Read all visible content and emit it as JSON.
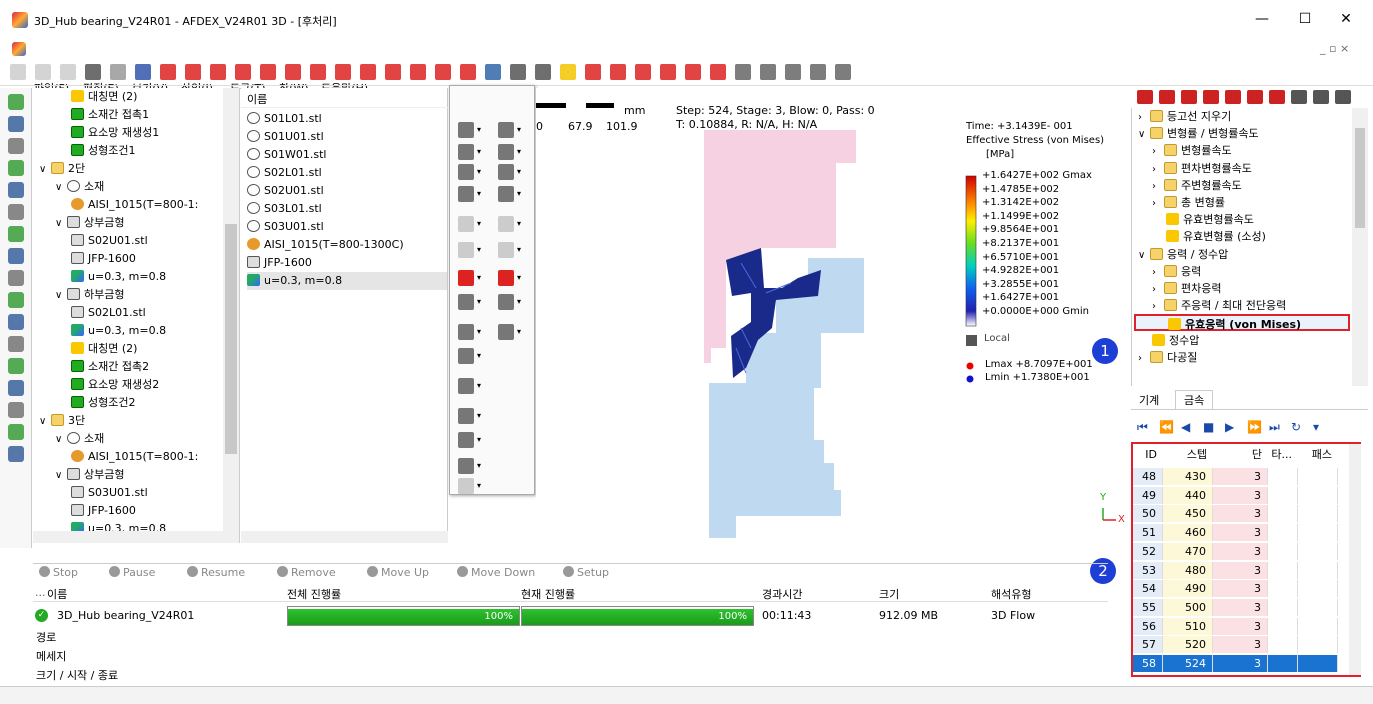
{
  "window": {
    "title": "3D_Hub bearing_V24R01 - AFDEX_V24R01 3D - [후처리]",
    "minimize": "—",
    "maximize": "☐",
    "close": "✕"
  },
  "menu": [
    "파일(F)",
    "편집(E)",
    "보기(V)",
    "삽입(I)",
    "도구(T)",
    "창(W)",
    "도움말(H)"
  ],
  "mdi_controls": "_ ▫ ×",
  "tree": [
    {
      "label": "대칭면 (2)",
      "icon": "i-sym",
      "indent": 2
    },
    {
      "label": "소재간 접촉1",
      "icon": "i-part",
      "indent": 2
    },
    {
      "label": "요소망 재생성1",
      "icon": "i-part",
      "indent": 2
    },
    {
      "label": "성형조건1",
      "icon": "i-part",
      "indent": 2
    },
    {
      "label": "2단",
      "icon": "i-folder",
      "indent": 0,
      "exp": "∨"
    },
    {
      "label": "소재",
      "icon": "i-stl",
      "indent": 1,
      "exp": "∨"
    },
    {
      "label": "AISI_1015(T=800-1:",
      "icon": "i-mat",
      "indent": 2
    },
    {
      "label": "상부금형",
      "icon": "i-die",
      "indent": 1,
      "exp": "∨"
    },
    {
      "label": "S02U01.stl",
      "icon": "i-die",
      "indent": 2
    },
    {
      "label": "JFP-1600",
      "icon": "i-die",
      "indent": 2
    },
    {
      "label": "u=0.3, m=0.8",
      "icon": "i-fric",
      "indent": 2
    },
    {
      "label": "하부금형",
      "icon": "i-die",
      "indent": 1,
      "exp": "∨"
    },
    {
      "label": "S02L01.stl",
      "icon": "i-die",
      "indent": 2
    },
    {
      "label": "u=0.3, m=0.8",
      "icon": "i-fric",
      "indent": 2
    },
    {
      "label": "대칭면 (2)",
      "icon": "i-sym",
      "indent": 2
    },
    {
      "label": "소재간 접촉2",
      "icon": "i-part",
      "indent": 2
    },
    {
      "label": "요소망 재생성2",
      "icon": "i-part",
      "indent": 2
    },
    {
      "label": "성형조건2",
      "icon": "i-part",
      "indent": 2
    },
    {
      "label": "3단",
      "icon": "i-folder",
      "indent": 0,
      "exp": "∨"
    },
    {
      "label": "소재",
      "icon": "i-stl",
      "indent": 1,
      "exp": "∨"
    },
    {
      "label": "AISI_1015(T=800-1:",
      "icon": "i-mat",
      "indent": 2
    },
    {
      "label": "상부금형",
      "icon": "i-die",
      "indent": 1,
      "exp": "∨"
    },
    {
      "label": "S03U01.stl",
      "icon": "i-die",
      "indent": 2
    },
    {
      "label": "JFP-1600",
      "icon": "i-die",
      "indent": 2
    },
    {
      "label": "u=0.3, m=0.8",
      "icon": "i-fric",
      "indent": 2
    }
  ],
  "list": {
    "header": "이름",
    "items": [
      {
        "label": "S01L01.stl",
        "icon": "i-stl"
      },
      {
        "label": "S01U01.stl",
        "icon": "i-stl"
      },
      {
        "label": "S01W01.stl",
        "icon": "i-stl"
      },
      {
        "label": "S02L01.stl",
        "icon": "i-stl"
      },
      {
        "label": "S02U01.stl",
        "icon": "i-stl"
      },
      {
        "label": "S03L01.stl",
        "icon": "i-stl"
      },
      {
        "label": "S03U01.stl",
        "icon": "i-stl"
      },
      {
        "label": "AISI_1015(T=800-1300C)",
        "icon": "i-mat"
      },
      {
        "label": "JFP-1600",
        "icon": "i-die"
      },
      {
        "label": "u=0.3, m=0.8",
        "icon": "i-fric"
      }
    ]
  },
  "viewport": {
    "scale_unit": "mm",
    "scale_ticks": [
      "0",
      "67.9",
      "101.9"
    ],
    "step_info": "Step: 524, Stage: 3, Blow: 0, Pass: 0",
    "time_info": "T: 0.10884, R: N/A, H: N/A",
    "time": "Time: +3.1439E- 001",
    "quantity": "Effective Stress (von Mises)",
    "unit": "[MPa]",
    "legend": [
      "+1.6427E+002 Gmax",
      "+1.4785E+002",
      "+1.3142E+002",
      "+1.1499E+002",
      "+9.8564E+001",
      "+8.2137E+001",
      "+6.5710E+001",
      "+4.9282E+001",
      "+3.2855E+001",
      "+1.6427E+001",
      "+0.0000E+000 Gmin"
    ],
    "local": "Local",
    "lmax": "Lmax +8.7097E+001",
    "lmin": "Lmin  +1.7380E+001",
    "axis_y": "Y",
    "axis_x": "X",
    "colors": {
      "upper_die": "#f6cfe0",
      "lower_die": "#bcd7f0",
      "workpiece": "#1a2a8a"
    }
  },
  "result_tree": [
    {
      "label": "등고선 지우기",
      "icon": "i-folder",
      "indent": 0,
      "exp": "›"
    },
    {
      "label": "변형률 / 변형률속도",
      "icon": "i-folder",
      "indent": 0,
      "exp": "∨"
    },
    {
      "label": "변형률속도",
      "icon": "i-folder",
      "indent": 1,
      "exp": "›"
    },
    {
      "label": "편차변형률속도",
      "icon": "i-folder",
      "indent": 1,
      "exp": "›"
    },
    {
      "label": "주변형률속도",
      "icon": "i-folder",
      "indent": 1,
      "exp": "›"
    },
    {
      "label": "총 변형률",
      "icon": "i-folder",
      "indent": 1,
      "exp": "›"
    },
    {
      "label": "유효변형률속도",
      "icon": "i-sym",
      "indent": 2
    },
    {
      "label": "유효변형률 (소성)",
      "icon": "i-sym",
      "indent": 2
    },
    {
      "label": "응력 / 정수압",
      "icon": "i-folder",
      "indent": 0,
      "exp": "∨"
    },
    {
      "label": "응력",
      "icon": "i-folder",
      "indent": 1,
      "exp": "›"
    },
    {
      "label": "편차응력",
      "icon": "i-folder",
      "indent": 1,
      "exp": "›"
    },
    {
      "label": "주응력 / 최대 전단응력",
      "icon": "i-folder",
      "indent": 1,
      "exp": "›"
    },
    {
      "label": "유효응력 (von Mises)",
      "icon": "i-sym",
      "indent": 1,
      "selected": true
    },
    {
      "label": "정수압",
      "icon": "i-sym",
      "indent": 1
    },
    {
      "label": "다공질",
      "icon": "i-folder",
      "indent": 0,
      "exp": "›"
    }
  ],
  "markers": [
    "1",
    "2"
  ],
  "tabs": [
    "기계",
    "금속"
  ],
  "player_icons": [
    "⏮",
    "⏪",
    "◀",
    "■",
    "▶",
    "⏩",
    "⏭",
    "↻",
    "▾"
  ],
  "grid": {
    "headers": [
      "ID",
      "스텝",
      "단",
      "타...",
      "패스"
    ],
    "rows": [
      [
        "48",
        "430",
        "3",
        "",
        ""
      ],
      [
        "49",
        "440",
        "3",
        "",
        ""
      ],
      [
        "50",
        "450",
        "3",
        "",
        ""
      ],
      [
        "51",
        "460",
        "3",
        "",
        ""
      ],
      [
        "52",
        "470",
        "3",
        "",
        ""
      ],
      [
        "53",
        "480",
        "3",
        "",
        ""
      ],
      [
        "54",
        "490",
        "3",
        "",
        ""
      ],
      [
        "55",
        "500",
        "3",
        "",
        ""
      ],
      [
        "56",
        "510",
        "3",
        "",
        ""
      ],
      [
        "57",
        "520",
        "3",
        "",
        ""
      ],
      [
        "58",
        "524",
        "3",
        "",
        ""
      ]
    ],
    "selected_row": 10
  },
  "job_toolbar": [
    "Stop",
    "Pause",
    "Resume",
    "Remove",
    "Move Up",
    "Move Down",
    "Setup"
  ],
  "job_headers": [
    "이름",
    "전체 진행률",
    "현재 진행률",
    "경과시간",
    "크기",
    "해석유형"
  ],
  "job": {
    "name": "3D_Hub bearing_V24R01",
    "overall": "100%",
    "overall_value": 1.0,
    "current": "100%",
    "current_value": 1.0,
    "elapsed": "00:11:43",
    "size": "912.09 MB",
    "type": "3D Flow"
  },
  "job_info": [
    "경로",
    "메세지",
    "크기 / 시작 / 종료"
  ]
}
